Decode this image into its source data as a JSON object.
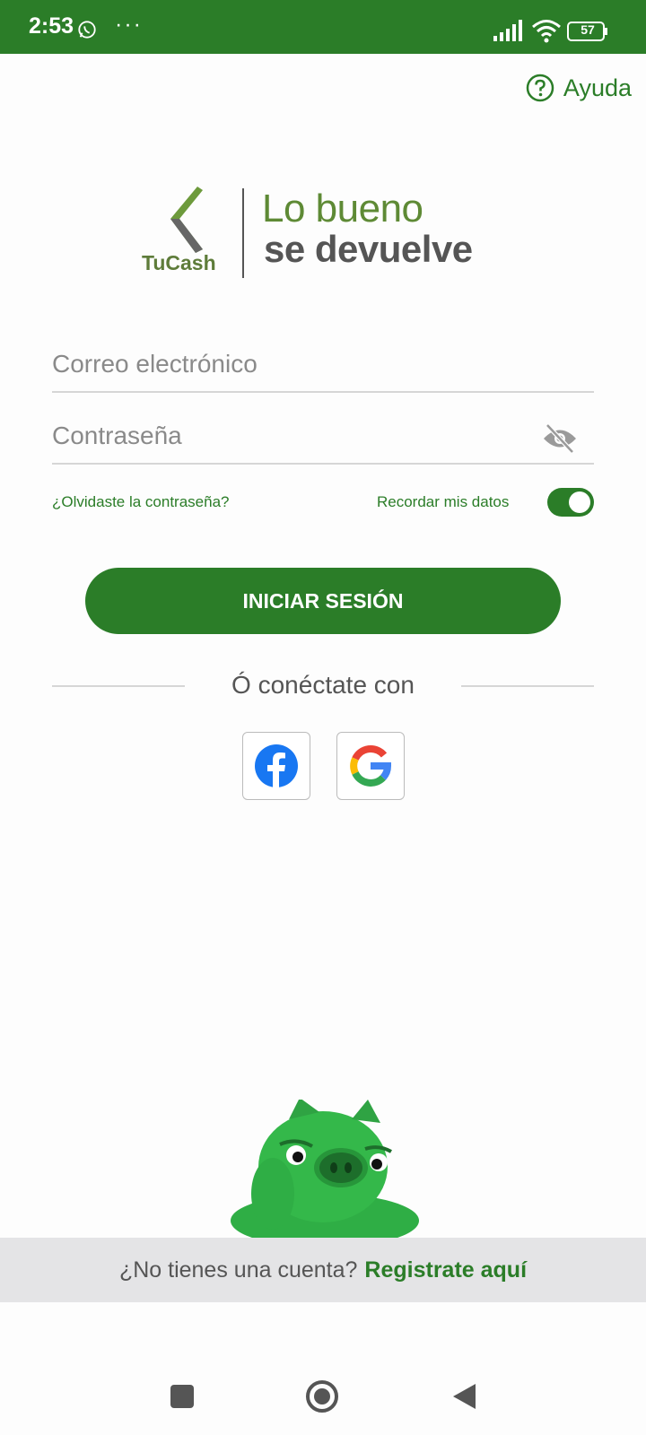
{
  "status_bar": {
    "time": "2:53",
    "dots": "···",
    "battery": "57",
    "icons": [
      "whatsapp-icon",
      "signal-icon",
      "wifi-icon",
      "battery-icon"
    ]
  },
  "help": {
    "label": "Ayuda",
    "icon": "help-circle-icon"
  },
  "logo": {
    "brand": "TuCash",
    "tagline_line1": "Lo bueno",
    "tagline_line2": "se devuelve"
  },
  "form": {
    "email_placeholder": "Correo electrónico",
    "email_value": "",
    "password_placeholder": "Contraseña",
    "password_value": "",
    "forgot_password": "¿Olvidaste la contraseña?",
    "remember_label": "Recordar mis datos",
    "remember_on": true,
    "login_button": "INICIAR SESIÓN"
  },
  "social": {
    "divider_text": "Ó conéctate con",
    "buttons": [
      "facebook-icon",
      "google-icon"
    ]
  },
  "register": {
    "prompt": "¿No tienes una cuenta?",
    "link": "Registrate aquí"
  },
  "colors": {
    "brand_green": "#2b7d28",
    "logo_green": "#5e8a35",
    "register_bar": "#e4e4e6"
  }
}
